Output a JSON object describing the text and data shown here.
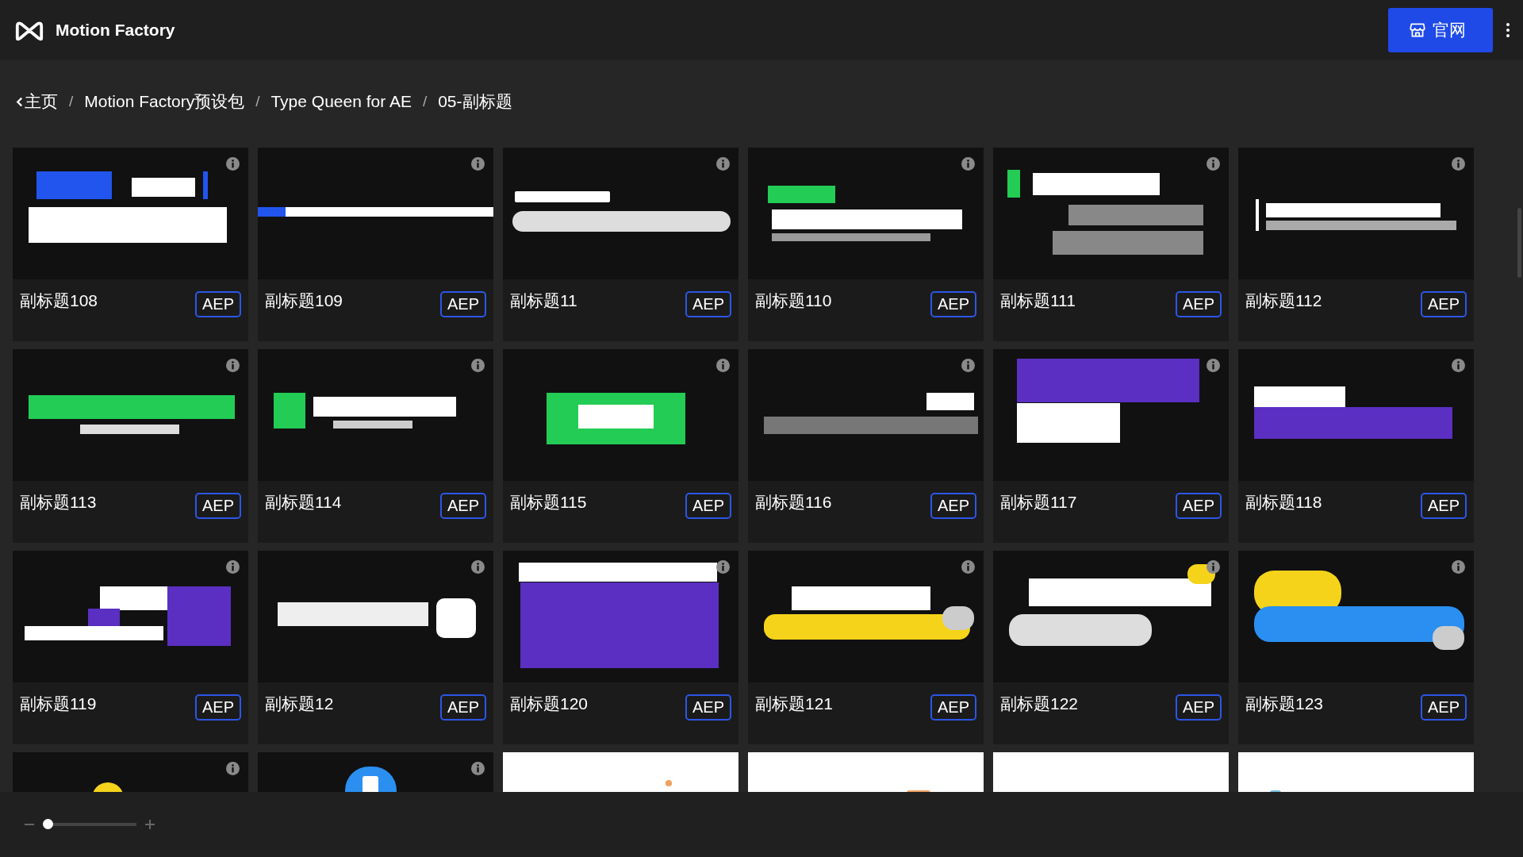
{
  "header": {
    "title": "Motion Factory",
    "website_button": "官网"
  },
  "breadcrumb": {
    "separator": "/",
    "items": [
      "主页",
      "Motion Factory预设包",
      "Type Queen for AE",
      "05-副标题"
    ]
  },
  "cards": [
    {
      "kind": "template",
      "title": "副标题108",
      "badge": "AEP"
    },
    {
      "kind": "template",
      "title": "副标题109",
      "badge": "AEP"
    },
    {
      "kind": "template",
      "title": "副标题11",
      "badge": "AEP"
    },
    {
      "kind": "template",
      "title": "副标题110",
      "badge": "AEP"
    },
    {
      "kind": "template",
      "title": "副标题111",
      "badge": "AEP"
    },
    {
      "kind": "template",
      "title": "副标题112",
      "badge": "AEP"
    },
    {
      "kind": "template",
      "title": "副标题113",
      "badge": "AEP"
    },
    {
      "kind": "template",
      "title": "副标题114",
      "badge": "AEP"
    },
    {
      "kind": "template",
      "title": "副标题115",
      "badge": "AEP"
    },
    {
      "kind": "template",
      "title": "副标题116",
      "badge": "AEP"
    },
    {
      "kind": "template",
      "title": "副标题117",
      "badge": "AEP"
    },
    {
      "kind": "template",
      "title": "副标题118",
      "badge": "AEP"
    },
    {
      "kind": "template",
      "title": "副标题119",
      "badge": "AEP"
    },
    {
      "kind": "template",
      "title": "副标题12",
      "badge": "AEP"
    },
    {
      "kind": "template",
      "title": "副标题120",
      "badge": "AEP"
    },
    {
      "kind": "template",
      "title": "副标题121",
      "badge": "AEP"
    },
    {
      "kind": "template",
      "title": "副标题122",
      "badge": "AEP"
    },
    {
      "kind": "template",
      "title": "副标题123",
      "badge": "AEP"
    },
    {
      "kind": "picture"
    },
    {
      "kind": "picture"
    },
    {
      "kind": "picture"
    },
    {
      "kind": "picture"
    },
    {
      "kind": "picture"
    },
    {
      "kind": "picture"
    }
  ],
  "zoom_slider": {
    "level": 0
  }
}
